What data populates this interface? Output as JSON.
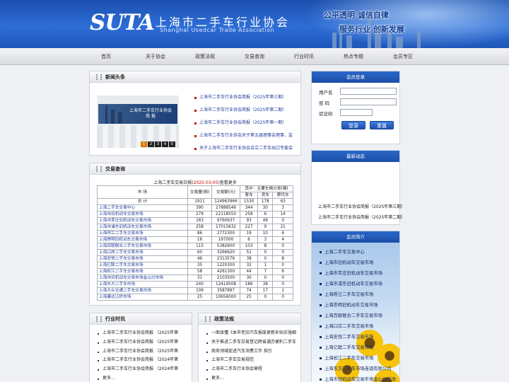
{
  "header": {
    "logo": "SUTA",
    "title_cn": "上海市二手车行业协会",
    "title_en": "Shanghai Usedcar Trade Association",
    "slogan1": "公平透明 诚信自律",
    "slogan2": "服务行业 创新发展",
    "colors": {
      "primary": "#1b4fae",
      "accent": "#e07a00"
    }
  },
  "nav": [
    "首页",
    "关于协会",
    "政策法规",
    "交易查询",
    "行业时讯",
    "热点专题",
    "会员专区"
  ],
  "news": {
    "title": "新闻头条",
    "image_title": "上海市二手车行业协会",
    "image_subtitle": "简 报",
    "pages": [
      "1",
      "2",
      "3",
      "4",
      "5"
    ],
    "items": [
      {
        "text": "上海市二手车行业协会简报",
        "date": "（2025年第三期）"
      },
      {
        "text": "上海市二手车行业协会简报",
        "date": "（2025年第二期）"
      },
      {
        "text": "上海市二手车行业协会简报",
        "date": "（2025年第一期）"
      },
      {
        "text": "上海市二手车行业协会关于第五届理事会理事、监",
        "date": ""
      },
      {
        "text": "关于上海市二手车行业协会设立二手车出口专委会",
        "date": ""
      }
    ]
  },
  "trade": {
    "title": "交易查询",
    "caption_pre": "上海二手车交易日报(",
    "caption_date": "2025-03-05",
    "caption_post": ")查看更多",
    "headers": {
      "market": "市 场",
      "count": "交易量(辆)",
      "amount": "交易额(元)",
      "group": "其中：主要车辆分类(辆)",
      "car": "客车",
      "truck": "货车",
      "moto": "摩托车"
    },
    "total": {
      "name": "总 计",
      "count": "1911",
      "amount": "124963966",
      "car": "1530",
      "truck": "178",
      "moto": "63"
    },
    "rows": [
      {
        "name": "上海二手车交易中心",
        "count": "390",
        "amount": "27888546",
        "car": "344",
        "truck": "30",
        "moto": "3"
      },
      {
        "name": "上海市旧机动车交易市场",
        "count": "279",
        "amount": "22118550",
        "car": "258",
        "truck": "6",
        "moto": "14"
      },
      {
        "name": "上海市莘庄旧机动车交易市场",
        "count": "163",
        "amount": "9760637",
        "car": "93",
        "truck": "49",
        "moto": "0"
      },
      {
        "name": "上海市浦东旧机动车交易市场",
        "count": "258",
        "amount": "17015632",
        "car": "227",
        "truck": "9",
        "moto": "21"
      },
      {
        "name": "上海呼兰二手车交易市场",
        "count": "86",
        "amount": "2772300",
        "car": "19",
        "truck": "10",
        "moto": "6"
      },
      {
        "name": "上海崇明旧机动车交易市场",
        "count": "16",
        "amount": "197000",
        "car": "6",
        "truck": "3",
        "moto": "4"
      },
      {
        "name": "上海百联联合二手车交易市场",
        "count": "115",
        "amount": "5382600",
        "car": "103",
        "truck": "8",
        "moto": "0"
      },
      {
        "name": "上海口岸二手车交易市场",
        "count": "60",
        "amount": "3266620",
        "car": "51",
        "truck": "0",
        "moto": "0"
      },
      {
        "name": "上海安悦二手车交易市场",
        "count": "46",
        "amount": "2313576",
        "car": "38",
        "truck": "0",
        "moto": "8"
      },
      {
        "name": "上海亿联二手车交易市场",
        "count": "35",
        "amount": "1220300",
        "car": "32",
        "truck": "1",
        "moto": "0"
      },
      {
        "name": "上海松江二手车交易市场",
        "count": "58",
        "amount": "4261300",
        "car": "44",
        "truck": "7",
        "moto": "6"
      },
      {
        "name": "上海市旧机动车交易市场金山分市场",
        "count": "31",
        "amount": "2103500",
        "car": "30",
        "truck": "0",
        "moto": "0"
      },
      {
        "name": "上海东方二手车市场",
        "count": "240",
        "amount": "12419508",
        "car": "186",
        "truck": "38",
        "moto": "0"
      },
      {
        "name": "上海大众交通二手车交易市场",
        "count": "109",
        "amount": "3587897",
        "car": "74",
        "truck": "17",
        "moto": "1"
      },
      {
        "name": "上海康达江桥市场",
        "count": "25",
        "amount": "10656000",
        "car": "25",
        "truck": "0",
        "moto": "0"
      }
    ]
  },
  "login": {
    "title": "会员登录",
    "user_label": "用户名",
    "pass_label": "密  码",
    "code_label": "验证码",
    "login_button": "登录",
    "reset_button": "重置"
  },
  "dynamic": {
    "title": "最新动态",
    "items": [
      "上海市二手车行业协会简报（2025年第三期）",
      "上海市二手车行业协会简报（2025年第二期）"
    ]
  },
  "intro": {
    "title": "会员简介",
    "items": [
      "上海二手车交易中心",
      "上海市旧机动车交易市场",
      "上海市莘庄旧机动车交易市场",
      "上海市浦东旧机动车交易市场",
      "上海呼兰二手车交易市场",
      "上海崇明旧机动车交易市场",
      "上海百联联合二手车交易市场",
      "上海口岸二手车交易市场",
      "上海安悦二手车交易市场",
      "上海亿联二手车交易市场",
      "上海松江二手车交易市场",
      "上海东方二手车市场连锁有限公司",
      "上海市旧机动车交易市场金山分市场"
    ]
  },
  "industry": {
    "title": "行业时讯",
    "items": [
      "上海市二手车行业协会简报 （2025年第",
      "上海市二手车行业协会简报 （2025年第",
      "上海市二手车行业协会简报 （2025年第",
      "上海市二手车行业协会简报 （2024年第",
      "上海市二手车行业协会简报 （2024年第",
      "更多..."
    ]
  },
  "policy": {
    "title": "政策法规",
    "items": [
      "一图读懂《本市老旧汽车报废更新补贴实施细",
      "关于推进二手车交易登记跨省通办便利二手车",
      "商务领域促进汽车消费工作 指引",
      "上海市二手车交易规范",
      "上海市二手车行业协会章程",
      "更多..."
    ]
  }
}
